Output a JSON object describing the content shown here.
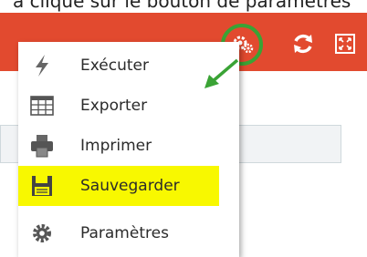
{
  "caption": {
    "text": "a cliqué sur le bouton de paramètres"
  },
  "toolbar": {
    "color": "#e24a2f",
    "icons": [
      "gears-icon",
      "refresh-icon",
      "fullscreen-icon"
    ],
    "highlight_color": "#3aa335"
  },
  "menu": {
    "items": [
      {
        "label": "Exécuter",
        "icon": "lightning-icon"
      },
      {
        "label": "Exporter",
        "icon": "table-grid-icon"
      },
      {
        "label": "Imprimer",
        "icon": "printer-icon"
      },
      {
        "label": "Sauvegarder",
        "icon": "floppy-disk-icon",
        "highlighted": true,
        "highlight_color": "#f8f800"
      },
      {
        "label": "Paramètres",
        "icon": "gear-icon"
      }
    ]
  }
}
